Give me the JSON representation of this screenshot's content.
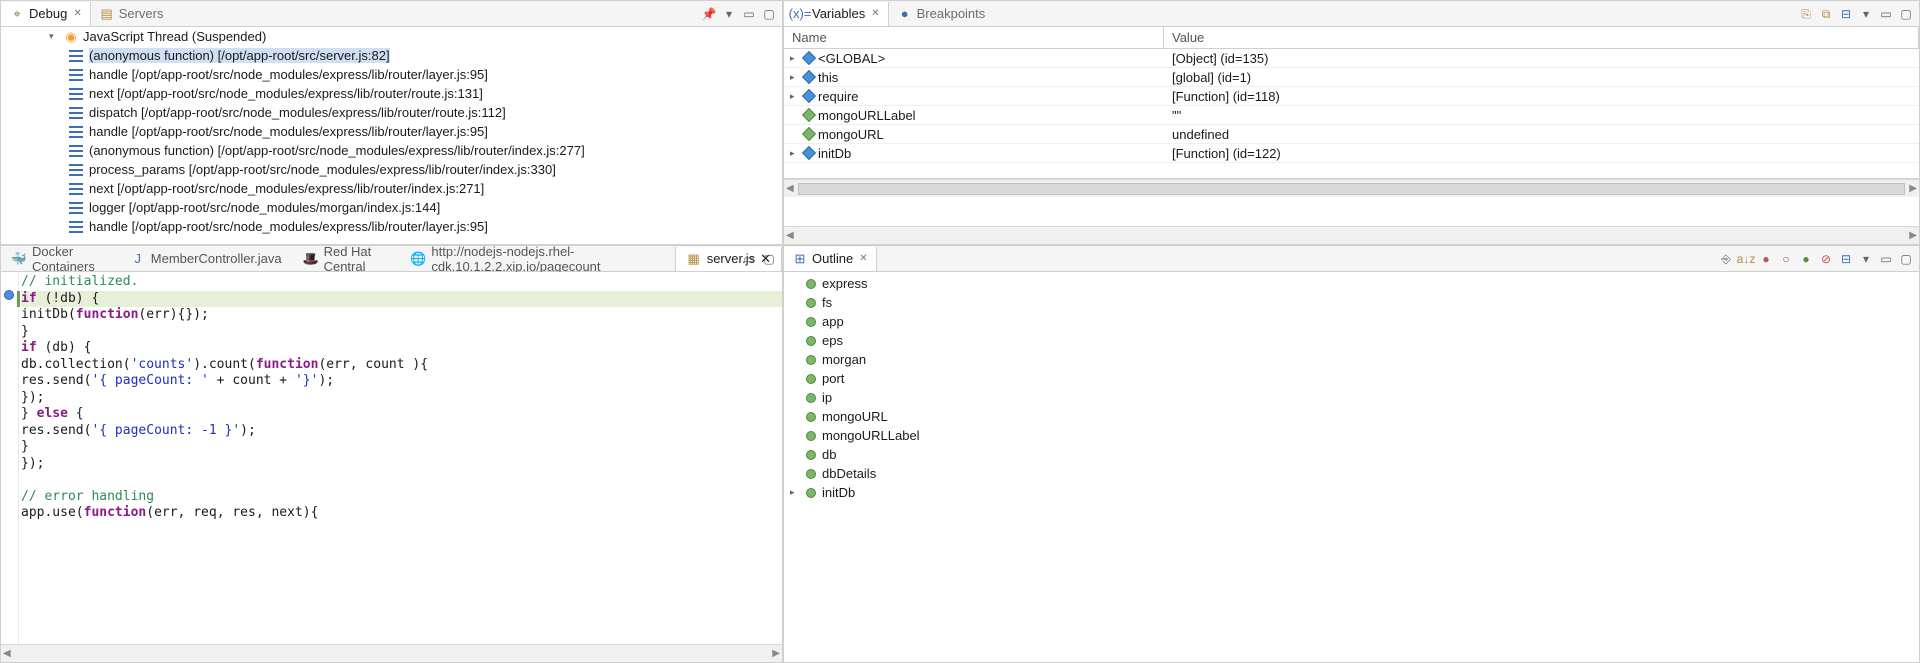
{
  "topLeft": {
    "tabs": [
      {
        "label": "Debug",
        "active": true,
        "icon": "bug-icon"
      },
      {
        "label": "Servers",
        "active": false,
        "icon": "servers-icon"
      }
    ],
    "thread": "JavaScript Thread (Suspended)",
    "stack": [
      "(anonymous function) [/opt/app-root/src/server.js:82]",
      "handle [/opt/app-root/src/node_modules/express/lib/router/layer.js:95]",
      "next [/opt/app-root/src/node_modules/express/lib/router/route.js:131]",
      "dispatch [/opt/app-root/src/node_modules/express/lib/router/route.js:112]",
      "handle [/opt/app-root/src/node_modules/express/lib/router/layer.js:95]",
      "(anonymous function) [/opt/app-root/src/node_modules/express/lib/router/index.js:277]",
      "process_params [/opt/app-root/src/node_modules/express/lib/router/index.js:330]",
      "next [/opt/app-root/src/node_modules/express/lib/router/index.js:271]",
      "logger [/opt/app-root/src/node_modules/morgan/index.js:144]",
      "handle [/opt/app-root/src/node_modules/express/lib/router/layer.js:95]"
    ],
    "selectedStack": 0
  },
  "topRight": {
    "tabs": [
      {
        "label": "Variables",
        "active": true,
        "icon": "variables-icon"
      },
      {
        "label": "Breakpoints",
        "active": false,
        "icon": "breakpoints-icon"
      }
    ],
    "cols": [
      "Name",
      "Value"
    ],
    "vars": [
      {
        "twist": "▸",
        "kind": "blue",
        "name": "<GLOBAL>",
        "value": "[Object]  (id=135)"
      },
      {
        "twist": "▸",
        "kind": "blue",
        "name": "this",
        "value": "[global]  (id=1)"
      },
      {
        "twist": "▸",
        "kind": "blue",
        "name": "require",
        "value": "[Function]  (id=118)"
      },
      {
        "twist": "",
        "kind": "green",
        "name": "mongoURLLabel",
        "value": "\"\""
      },
      {
        "twist": "",
        "kind": "green",
        "name": "mongoURL",
        "value": "undefined"
      },
      {
        "twist": "▸",
        "kind": "blue",
        "name": "initDb",
        "value": "[Function]  (id=122)"
      }
    ]
  },
  "editor": {
    "tabs": [
      {
        "icon": "docker-icon",
        "label": "Docker Containers"
      },
      {
        "icon": "java-icon",
        "label": "MemberController.java"
      },
      {
        "icon": "redhat-icon",
        "label": "Red Hat Central"
      },
      {
        "icon": "globe-icon",
        "label": "http://nodejs-nodejs.rhel-cdk.10.1.2.2.xip.io/pagecount"
      },
      {
        "icon": "js-icon",
        "label": "server.js",
        "active": true
      }
    ]
  },
  "code": {
    "l1": "// initialized.",
    "l2a": "if",
    "l2b": " (!db) {",
    "l3a": "initDb(",
    "l3b": "function",
    "l3c": "(err){});",
    "l4": "}",
    "l5a": "if",
    "l5b": " (db) {",
    "l6a": "db.collection(",
    "l6b": "'counts'",
    "l6c": ").count(",
    "l6d": "function",
    "l6e": "(err, count ){",
    "l7a": "res.send(",
    "l7b": "'{ pageCount: '",
    "l7c": " + count + ",
    "l7d": "'}'",
    "l7e": ");",
    "l8": "});",
    "l9a": "} ",
    "l9b": "else",
    "l9c": " {",
    "l10a": "res.send(",
    "l10b": "'{ pageCount: -1 }'",
    "l10c": ");",
    "l11": "}",
    "l12": "});",
    "l14": "// error handling",
    "l15a": "app.use(",
    "l15b": "function",
    "l15c": "(err, req, res, next){"
  },
  "outline": {
    "title": "Outline",
    "items": [
      "express",
      "fs",
      "app",
      "eps",
      "morgan",
      "port",
      "ip",
      "mongoURL",
      "mongoURLLabel",
      "db",
      "dbDetails",
      "initDb"
    ],
    "expandableIndex": 11
  }
}
